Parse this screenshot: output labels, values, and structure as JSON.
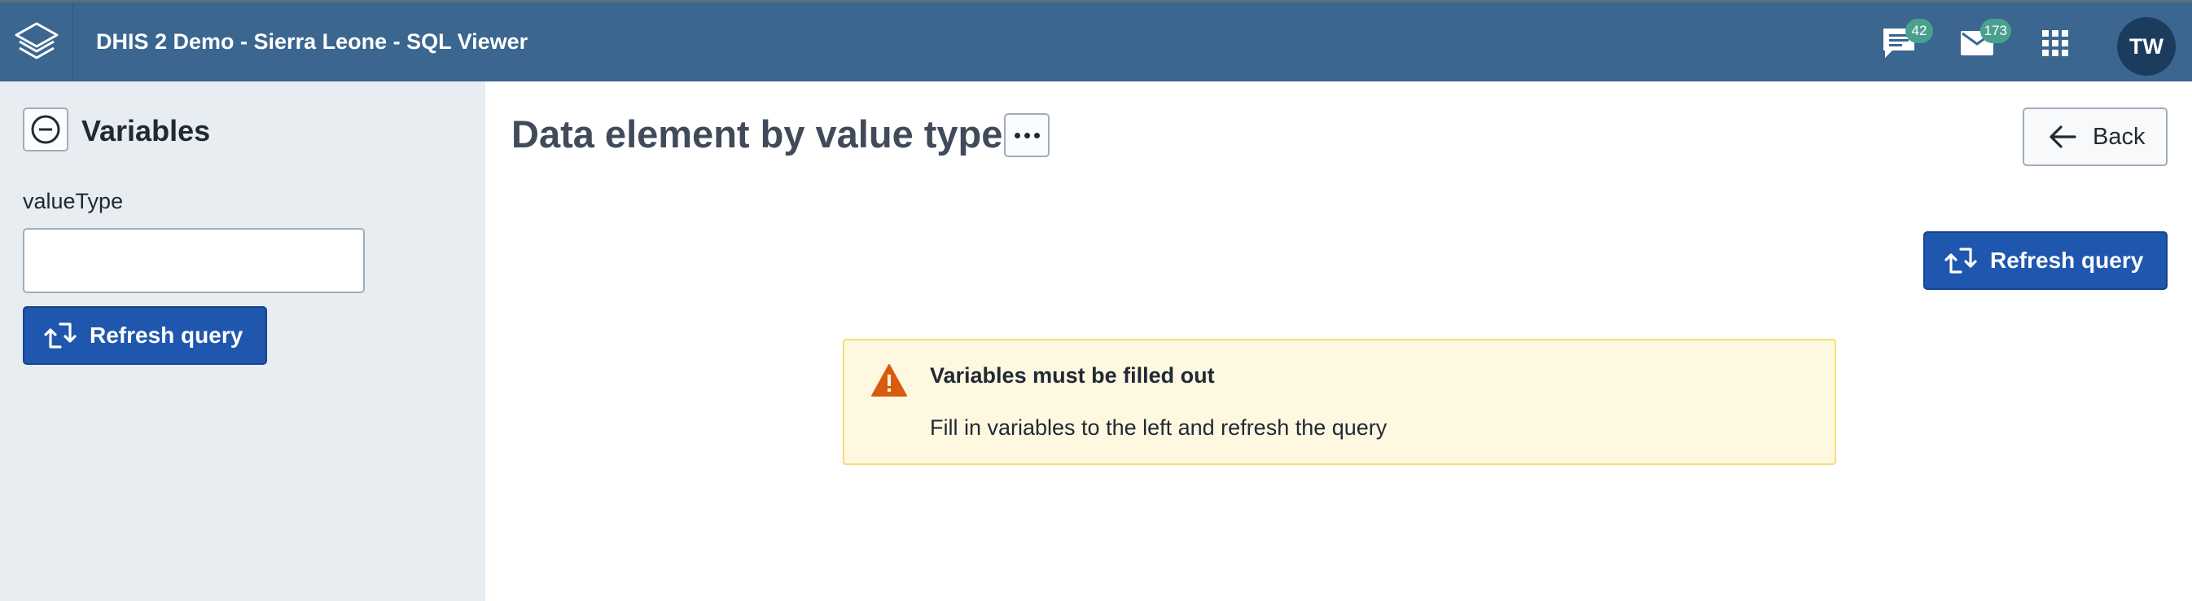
{
  "header": {
    "app_title": "DHIS 2 Demo - Sierra Leone - SQL Viewer",
    "messages_badge": "42",
    "interpretations_badge": "173",
    "avatar_initials": "TW",
    "bg_color": "#3a6690"
  },
  "sidebar": {
    "title": "Variables",
    "variable_label": "valueType",
    "variable_value": "",
    "refresh_label": "Refresh query"
  },
  "main": {
    "title": "Data element by value type",
    "back_label": "Back",
    "refresh_label": "Refresh query"
  },
  "notice": {
    "title": "Variables must be filled out",
    "message": "Fill in variables to the left and refresh the query",
    "type": "warning"
  },
  "icons": {
    "logo": "dhis2-logo-icon",
    "messages": "chat-icon",
    "interpretations": "mail-icon",
    "apps": "apps-grid-icon",
    "collapse": "minus-circle-icon",
    "more": "more-horizontal-icon",
    "back": "arrow-left-icon",
    "refresh": "refresh-icon",
    "warning": "warning-triangle-icon"
  },
  "colors": {
    "primary": "#1f56ae",
    "sidebar_bg": "#e8edf2",
    "warning_bg": "#fff8e1",
    "warning_icon": "#d95b0e"
  }
}
